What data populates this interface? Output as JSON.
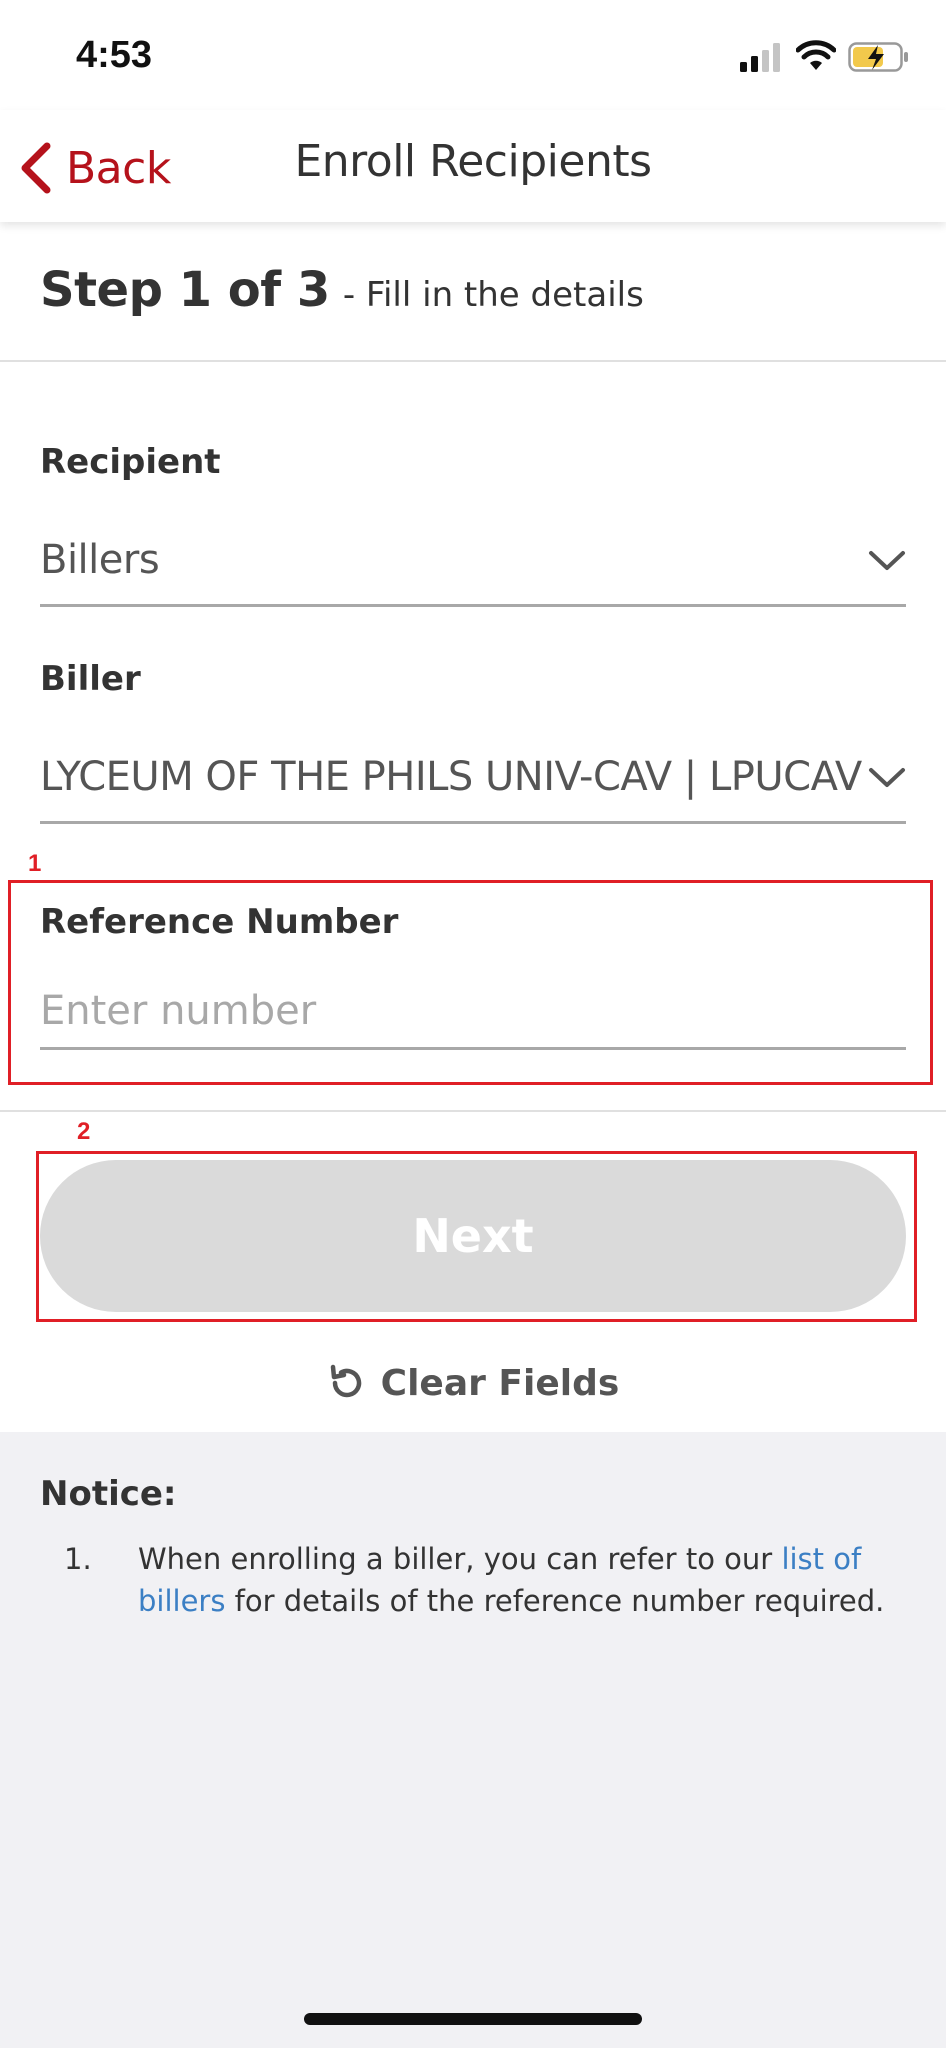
{
  "status_bar": {
    "time": "4:53"
  },
  "header": {
    "back_label": "Back",
    "title": "Enroll Recipients"
  },
  "step": {
    "main": "Step 1 of 3",
    "sub": "- Fill in the details"
  },
  "form": {
    "recipient": {
      "label": "Recipient",
      "value": "Billers"
    },
    "biller": {
      "label": "Biller",
      "value": "LYCEUM OF THE PHILS UNIV-CAV | LPUCAV"
    },
    "reference": {
      "label": "Reference Number",
      "placeholder": "Enter number",
      "value": ""
    }
  },
  "annotations": {
    "box1": "1",
    "box2": "2"
  },
  "actions": {
    "next_label": "Next",
    "clear_label": "Clear Fields"
  },
  "notice": {
    "title": "Notice:",
    "items": [
      {
        "number": "1.",
        "text_before": "When enrolling a biller, you can refer to our ",
        "link_text": "list of billers",
        "text_after": " for details of the reference number required."
      }
    ]
  },
  "colors": {
    "brand": "#b5121b",
    "link": "#3b7fc4",
    "annotation": "#e01f26",
    "disabled_button": "#dadada"
  },
  "icons": {
    "back": "chevron-left-icon",
    "dropdown": "chevron-down-icon",
    "clear": "refresh-icon",
    "signal": "cellular-signal-icon",
    "wifi": "wifi-icon",
    "battery": "battery-charging-icon"
  }
}
